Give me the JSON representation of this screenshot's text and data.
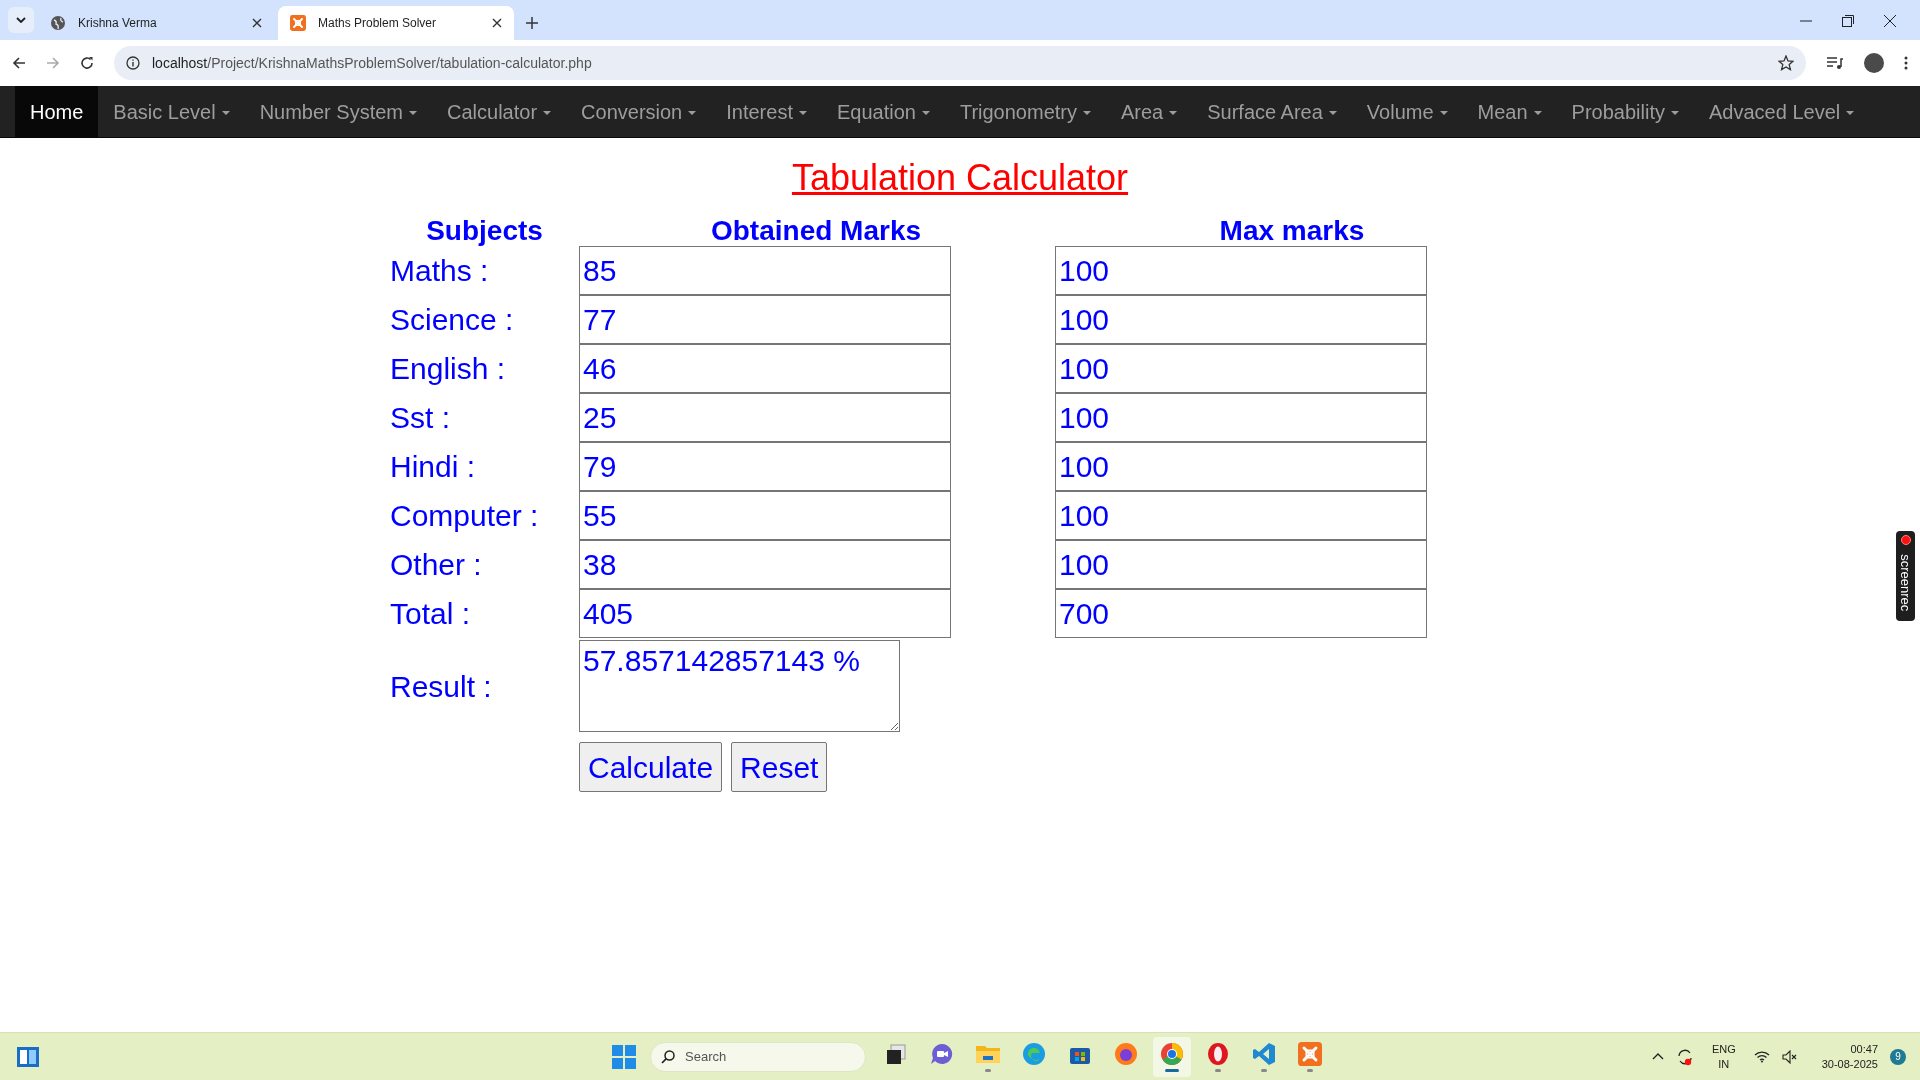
{
  "browser": {
    "tabs": [
      {
        "title": "Krishna Verma",
        "selected": false,
        "kind": "globe"
      },
      {
        "title": "Maths Problem Solver",
        "selected": true,
        "kind": "xampp"
      }
    ],
    "url_host": "localhost",
    "url_path": "/Project/KrishnaMathsProblemSolver/tabulation-calculator.php"
  },
  "nav": [
    {
      "label": "Home",
      "selected": true,
      "dropdown": false
    },
    {
      "label": "Basic Level",
      "selected": false,
      "dropdown": true
    },
    {
      "label": "Number System",
      "selected": false,
      "dropdown": true
    },
    {
      "label": "Calculator",
      "selected": false,
      "dropdown": true
    },
    {
      "label": "Conversion",
      "selected": false,
      "dropdown": true
    },
    {
      "label": "Interest",
      "selected": false,
      "dropdown": true
    },
    {
      "label": "Equation",
      "selected": false,
      "dropdown": true
    },
    {
      "label": "Trigonometry",
      "selected": false,
      "dropdown": true
    },
    {
      "label": "Area",
      "selected": false,
      "dropdown": true
    },
    {
      "label": "Surface Area",
      "selected": false,
      "dropdown": true
    },
    {
      "label": "Volume",
      "selected": false,
      "dropdown": true
    },
    {
      "label": "Mean",
      "selected": false,
      "dropdown": true
    },
    {
      "label": "Probability",
      "selected": false,
      "dropdown": true
    },
    {
      "label": "Advaced Level",
      "selected": false,
      "dropdown": true
    }
  ],
  "title": "Tabulation Calculator",
  "headers": [
    "Subjects",
    "Obtained Marks",
    "Max marks"
  ],
  "rows": [
    {
      "label": "Maths :",
      "obtained": "85",
      "max": "100"
    },
    {
      "label": "Science :",
      "obtained": "77",
      "max": "100"
    },
    {
      "label": "English :",
      "obtained": "46",
      "max": "100"
    },
    {
      "label": "Sst :",
      "obtained": "25",
      "max": "100"
    },
    {
      "label": "Hindi :",
      "obtained": "79",
      "max": "100"
    },
    {
      "label": "Computer :",
      "obtained": "55",
      "max": "100"
    },
    {
      "label": "Other :",
      "obtained": "38",
      "max": "100"
    },
    {
      "label": "Total :",
      "obtained": "405",
      "max": "700"
    }
  ],
  "result": {
    "label": "Result :",
    "value": "57.857142857143 %"
  },
  "buttons": [
    "Calculate",
    "Reset"
  ],
  "screenrec": "screenrec",
  "taskbar": {
    "search_placeholder": "Search",
    "apps": [
      {
        "kind": "taskview",
        "running": false,
        "selected": false
      },
      {
        "kind": "meet",
        "running": false,
        "selected": false
      },
      {
        "kind": "folder",
        "running": true,
        "selected": false
      },
      {
        "kind": "edge",
        "running": false,
        "selected": false
      },
      {
        "kind": "store",
        "running": false,
        "selected": false
      },
      {
        "kind": "firefox",
        "running": false,
        "selected": false
      },
      {
        "kind": "chrome",
        "running": true,
        "selected": true
      },
      {
        "kind": "opera",
        "running": true,
        "selected": false
      },
      {
        "kind": "vscode",
        "running": true,
        "selected": false
      },
      {
        "kind": "xampp",
        "running": true,
        "selected": false
      }
    ],
    "lang": [
      "ENG",
      "IN"
    ],
    "time": "00:47",
    "date": "30-08-2025",
    "notifications": "9"
  }
}
